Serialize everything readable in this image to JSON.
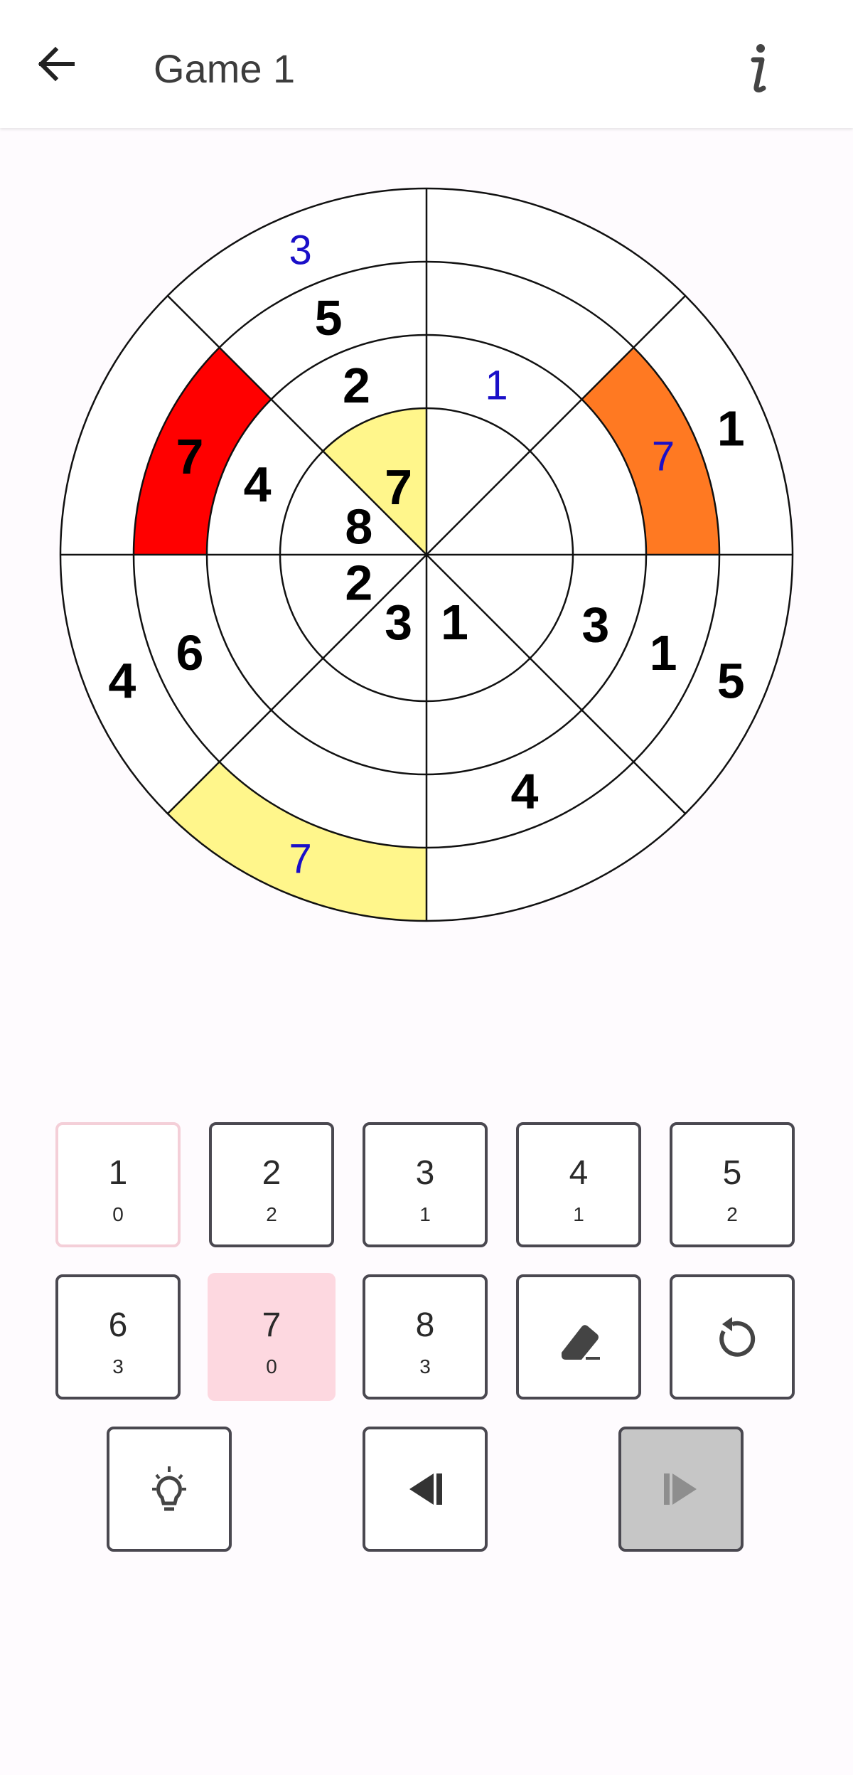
{
  "header": {
    "title": "Game 1",
    "back_icon": "arrow-left-icon",
    "info_icon": "info-icon"
  },
  "board": {
    "rings": 4,
    "sectors": 8,
    "colors": {
      "red": "#ff0000",
      "orange": "#ff7922",
      "yellow": "#fff68b",
      "given": "#000000",
      "entered": "#1a0fc8"
    },
    "highlighted_cells": [
      {
        "ring": 3,
        "sector": 6,
        "color": "red"
      },
      {
        "ring": 3,
        "sector": 1,
        "color": "orange"
      },
      {
        "ring": 1,
        "sector": 7,
        "color": "yellow"
      },
      {
        "ring": 4,
        "sector": 4,
        "color": "yellow"
      }
    ],
    "cells": [
      {
        "ring": 4,
        "sector": 7,
        "value": "3",
        "kind": "entered"
      },
      {
        "ring": 3,
        "sector": 7,
        "value": "5",
        "kind": "given"
      },
      {
        "ring": 2,
        "sector": 7,
        "value": "2",
        "kind": "given"
      },
      {
        "ring": 1,
        "sector": 7,
        "value": "7",
        "kind": "given"
      },
      {
        "ring": 2,
        "sector": 0,
        "value": "1",
        "kind": "entered"
      },
      {
        "ring": 4,
        "sector": 1,
        "value": "1",
        "kind": "given"
      },
      {
        "ring": 3,
        "sector": 1,
        "value": "7",
        "kind": "entered"
      },
      {
        "ring": 3,
        "sector": 6,
        "value": "7",
        "kind": "given"
      },
      {
        "ring": 2,
        "sector": 6,
        "value": "4",
        "kind": "given"
      },
      {
        "ring": 1,
        "sector": 6,
        "value": "8",
        "kind": "given"
      },
      {
        "ring": 1,
        "sector": 5,
        "value": "2",
        "kind": "given"
      },
      {
        "ring": 3,
        "sector": 5,
        "value": "6",
        "kind": "given"
      },
      {
        "ring": 4,
        "sector": 5,
        "value": "4",
        "kind": "given"
      },
      {
        "ring": 1,
        "sector": 4,
        "value": "3",
        "kind": "given"
      },
      {
        "ring": 1,
        "sector": 3,
        "value": "1",
        "kind": "given"
      },
      {
        "ring": 2,
        "sector": 2,
        "value": "3",
        "kind": "given"
      },
      {
        "ring": 3,
        "sector": 2,
        "value": "1",
        "kind": "given"
      },
      {
        "ring": 4,
        "sector": 2,
        "value": "5",
        "kind": "given"
      },
      {
        "ring": 3,
        "sector": 3,
        "value": "4",
        "kind": "given"
      },
      {
        "ring": 4,
        "sector": 4,
        "value": "7",
        "kind": "entered"
      }
    ]
  },
  "keypad": {
    "numbers": [
      {
        "label": "1",
        "count": "0"
      },
      {
        "label": "2",
        "count": "2"
      },
      {
        "label": "3",
        "count": "1"
      },
      {
        "label": "4",
        "count": "1"
      },
      {
        "label": "5",
        "count": "2"
      },
      {
        "label": "6",
        "count": "3"
      },
      {
        "label": "7",
        "count": "0"
      },
      {
        "label": "8",
        "count": "3"
      }
    ],
    "selected_number": "7",
    "erase_icon": "eraser-icon",
    "reset_icon": "rotate-ccw-icon",
    "hint_icon": "lightbulb-icon",
    "undo_icon": "step-back-icon",
    "redo_icon": "step-forward-icon"
  }
}
